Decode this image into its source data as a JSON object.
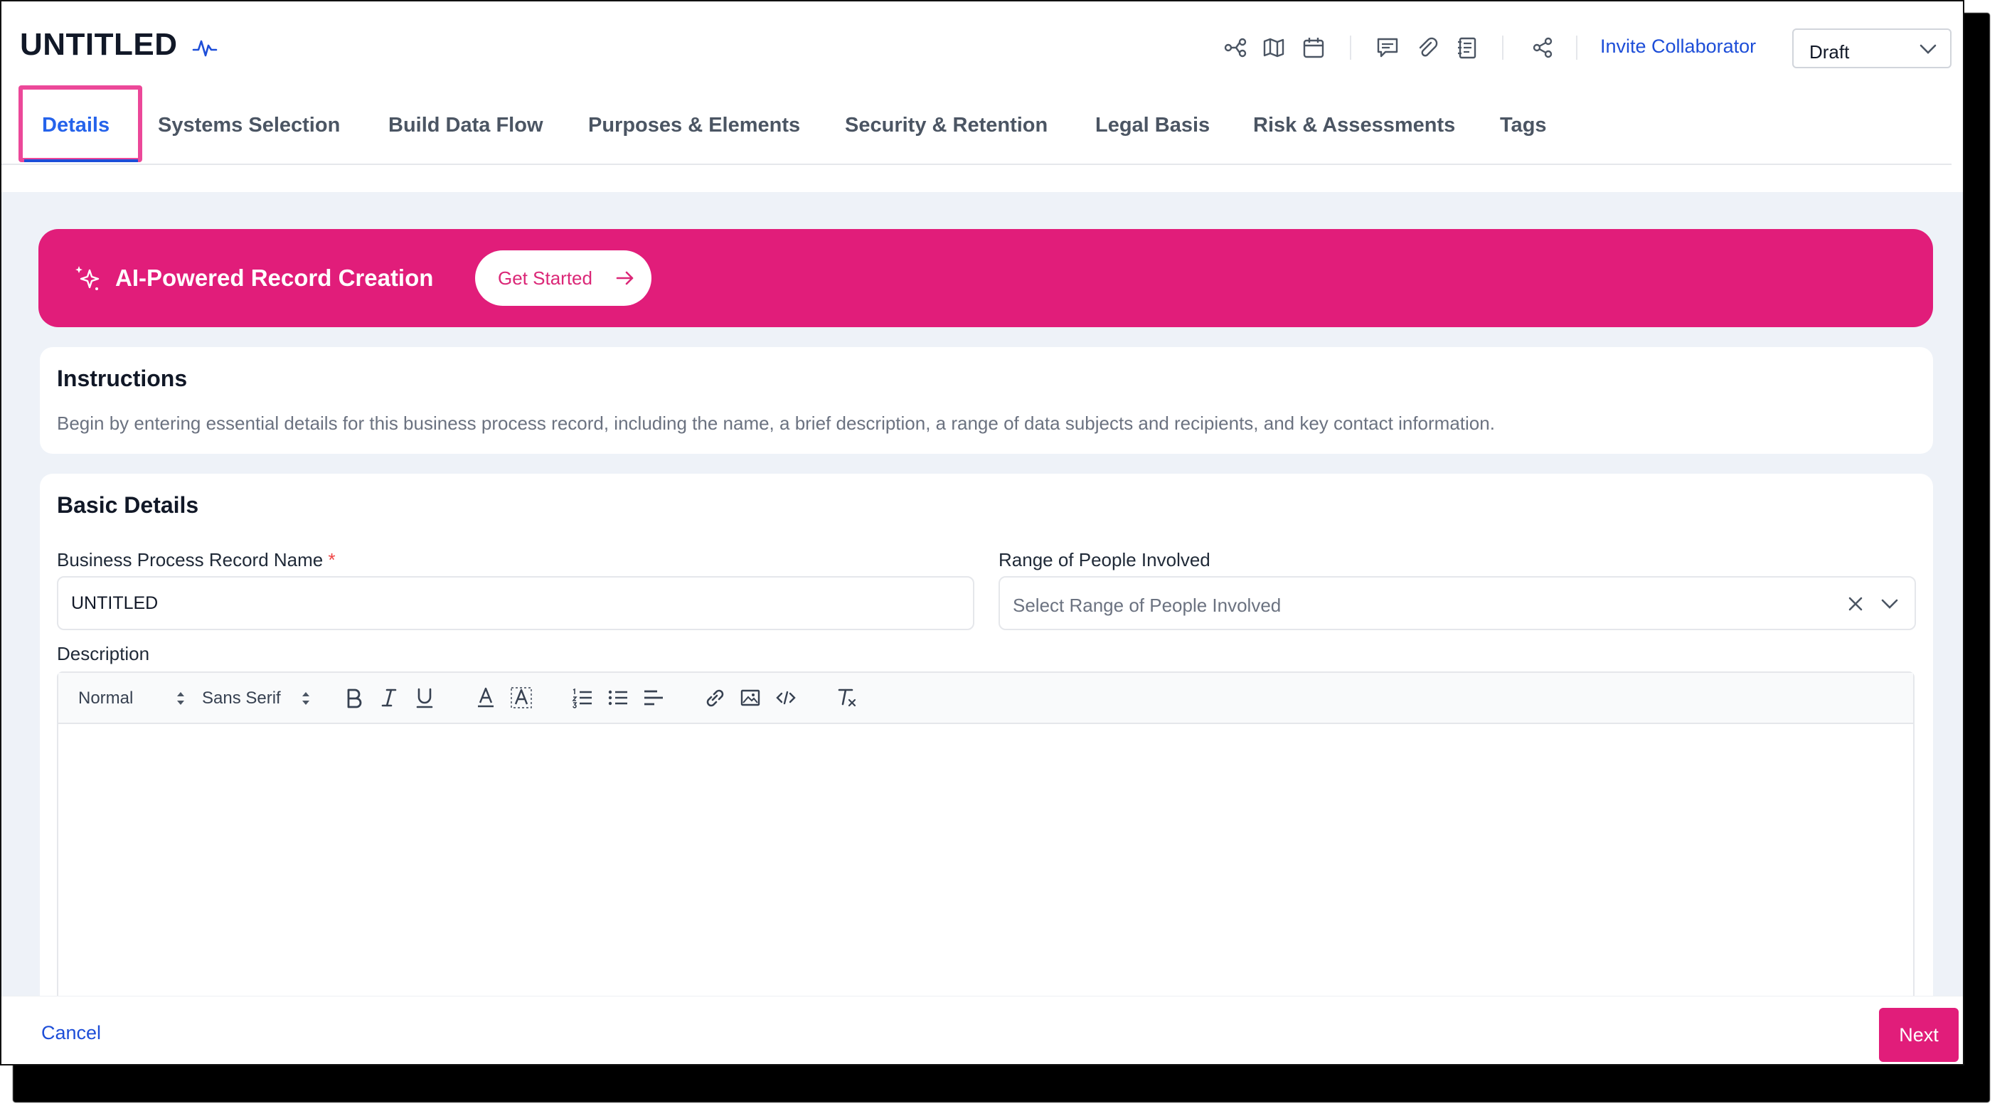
{
  "header": {
    "title": "UNTITLED",
    "invite_label": "Invite Collaborator",
    "status": {
      "selected": "Draft"
    },
    "toolbar_icons": [
      "flow-icon",
      "map-icon",
      "calendar-icon",
      "comment-icon",
      "attachment-icon",
      "notes-icon",
      "share-icon"
    ]
  },
  "tabs": [
    {
      "label": "Details",
      "active": true
    },
    {
      "label": "Systems Selection"
    },
    {
      "label": "Build Data Flow"
    },
    {
      "label": "Purposes & Elements"
    },
    {
      "label": "Security & Retention"
    },
    {
      "label": "Legal Basis"
    },
    {
      "label": "Risk & Assessments"
    },
    {
      "label": "Tags"
    }
  ],
  "ai_banner": {
    "title": "AI-Powered Record Creation",
    "cta": "Get Started"
  },
  "instructions": {
    "title": "Instructions",
    "text": "Begin by entering essential details for this business process record, including the name, a brief description, a range of data subjects and recipients, and key contact information."
  },
  "basic_details": {
    "title": "Basic Details",
    "name_label": "Business Process Record Name",
    "required_mark": "*",
    "name_value": "UNTITLED",
    "range_label": "Range of People Involved",
    "range_placeholder": "Select Range of People Involved",
    "description_label": "Description",
    "editor": {
      "format": "Normal",
      "font": "Sans Serif"
    }
  },
  "footer": {
    "cancel": "Cancel",
    "next": "Next"
  },
  "colors": {
    "accent_pink": "#e11d7a",
    "link_blue": "#1d4ed8",
    "tab_active": "#2563eb",
    "background": "#eef2f8"
  }
}
